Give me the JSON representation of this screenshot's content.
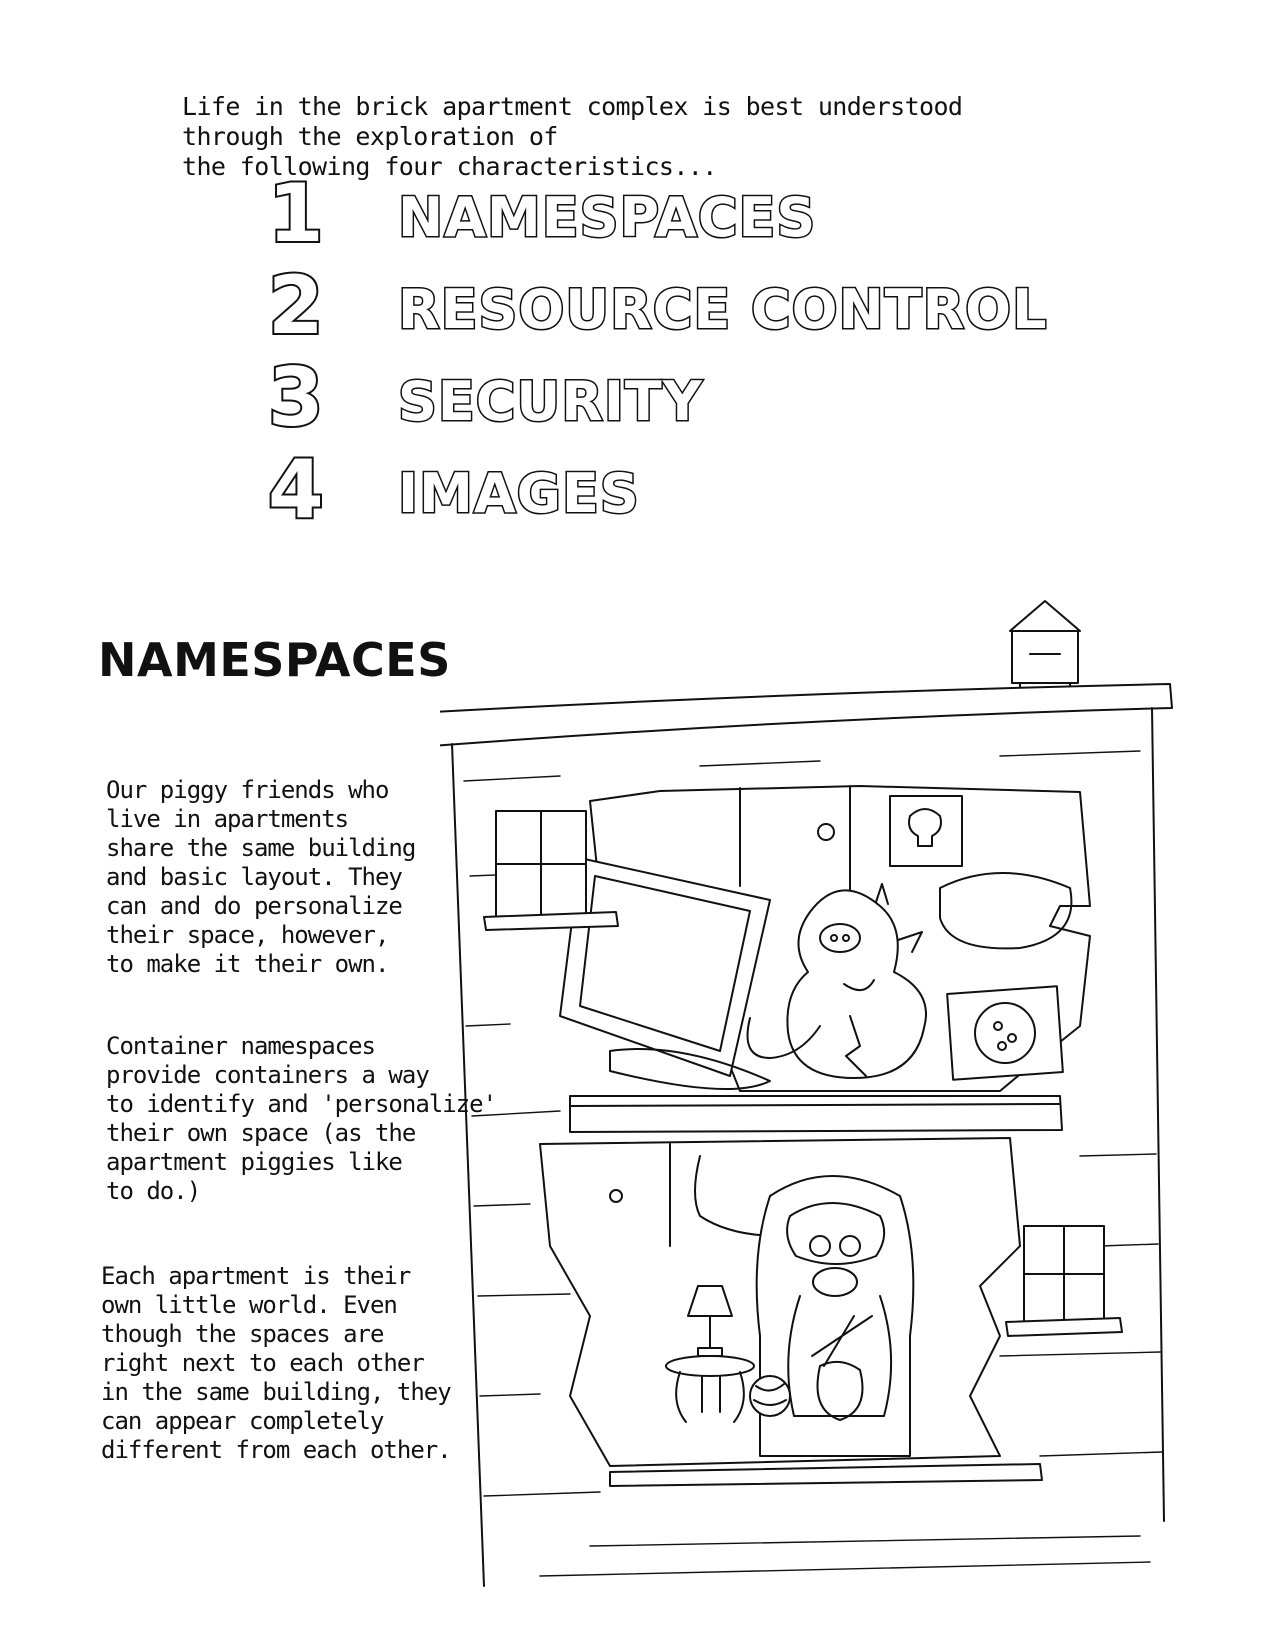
{
  "intro": {
    "line1": "Life in the brick apartment complex is best understood through the exploration of",
    "line2": "the following four characteristics..."
  },
  "characteristics": [
    {
      "number": "1",
      "label": "NAMESPACES"
    },
    {
      "number": "2",
      "label": "RESOURCE CONTROL"
    },
    {
      "number": "3",
      "label": "SECURITY"
    },
    {
      "number": "4",
      "label": "IMAGES"
    }
  ],
  "section": {
    "title": "NAMESPACES",
    "paragraphs": [
      "Our piggy friends who\nlive in apartments\nshare the same building\nand basic layout. They\ncan and do personalize\ntheir space, however,\nto make it their own.",
      "Container namespaces\nprovide containers a way\nto identify and 'personalize'\ntheir own space (as the\napartment piggies like\nto do.)",
      "Each apartment is their\nown little world.  Even\nthough the spaces are\nright next to each other\nin the same building, they\ncan appear completely\ndifferent from each other."
    ]
  },
  "illustration": {
    "subject": "brick apartment building with two piggy apartments",
    "line_color": "#111111",
    "fill_color": "#ffffff"
  }
}
